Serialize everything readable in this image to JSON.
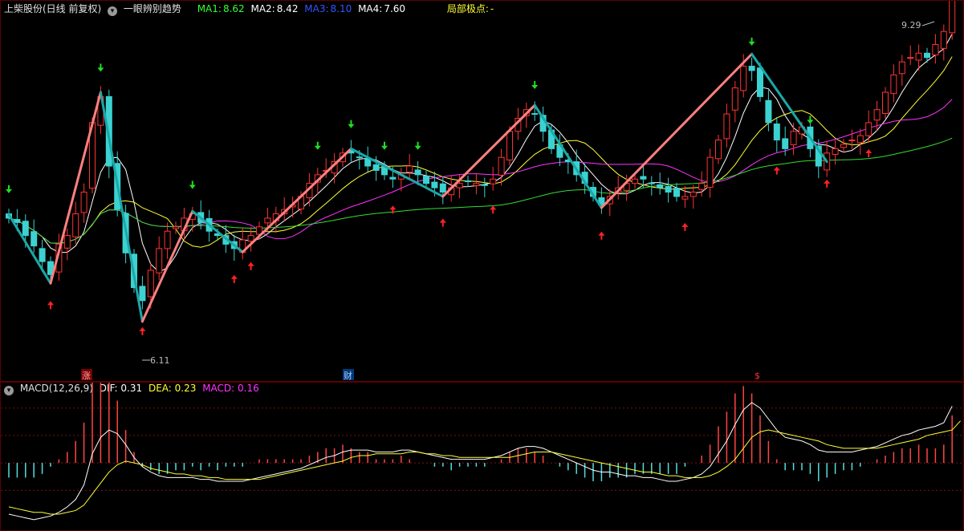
{
  "header": {
    "stock_title": "上柴股份(日线 前复权)",
    "indicator_name": "一眼辨别趋势",
    "ma1": {
      "label": "MA1:",
      "value": "8.62",
      "color": "#33ff33"
    },
    "ma2": {
      "label": "MA2:",
      "value": "8.42",
      "color": "#ffffff"
    },
    "ma3": {
      "label": "MA3:",
      "value": "8.10",
      "color": "#3355ff"
    },
    "ma4": {
      "label": "MA4:",
      "value": "7.60",
      "color": "#ffffff"
    },
    "extreme": {
      "label": "局部极点:",
      "value": "-",
      "color": "#ffff33"
    }
  },
  "macd_header": {
    "name": "MACD(12,26,9)",
    "dif": "DIF: 0.31",
    "dea": "DEA: 0.23",
    "macd": "MACD: 0.16"
  },
  "markers": {
    "up": "涨",
    "cai": "财",
    "s": "$"
  },
  "chart_data": [
    {
      "type": "candlestick",
      "price_range": [
        5.6,
        9.6
      ],
      "max_label": "9.29",
      "min_label": "6.11",
      "up_color": "#ff3333",
      "down_color": "#3cd2d2",
      "ma_colors": {
        "ma5": "#ffffff",
        "ma10": "#ffff33",
        "ma20": "#ff33ff",
        "ma60": "#33dd33"
      },
      "zigzag": [
        [
          0,
          7.34
        ],
        [
          5,
          6.55
        ],
        [
          11,
          8.75
        ],
        [
          16,
          6.11
        ],
        [
          22,
          7.38
        ],
        [
          28,
          6.91
        ],
        [
          41,
          8.1
        ],
        [
          52,
          7.55
        ],
        [
          63,
          8.6
        ],
        [
          71,
          7.42
        ],
        [
          89,
          9.19
        ],
        [
          98,
          7.95
        ]
      ],
      "zigzag_up_color": "#ff8080",
      "zigzag_down_color": "#1aa8a8",
      "turn_markers": [
        {
          "i": 0,
          "dir": "down"
        },
        {
          "i": 5,
          "dir": "up"
        },
        {
          "i": 11,
          "dir": "down"
        },
        {
          "i": 16,
          "dir": "up"
        },
        {
          "i": 22,
          "dir": "down"
        },
        {
          "i": 27,
          "dir": "up"
        },
        {
          "i": 29,
          "dir": "up"
        },
        {
          "i": 37,
          "dir": "down"
        },
        {
          "i": 41,
          "dir": "down"
        },
        {
          "i": 45,
          "dir": "down"
        },
        {
          "i": 46,
          "dir": "up"
        },
        {
          "i": 49,
          "dir": "down"
        },
        {
          "i": 52,
          "dir": "up"
        },
        {
          "i": 58,
          "dir": "up"
        },
        {
          "i": 63,
          "dir": "down"
        },
        {
          "i": 71,
          "dir": "up"
        },
        {
          "i": 81,
          "dir": "up"
        },
        {
          "i": 89,
          "dir": "down"
        },
        {
          "i": 92,
          "dir": "up"
        },
        {
          "i": 96,
          "dir": "down"
        },
        {
          "i": 98,
          "dir": "up"
        },
        {
          "i": 103,
          "dir": "up"
        }
      ],
      "close": [
        7.3,
        7.25,
        7.1,
        6.98,
        6.8,
        6.65,
        7.0,
        7.1,
        7.35,
        7.6,
        8.4,
        8.7,
        7.9,
        7.4,
        6.9,
        6.5,
        6.35,
        6.7,
        6.95,
        7.15,
        7.2,
        7.3,
        7.35,
        7.25,
        7.15,
        7.1,
        7.0,
        6.95,
        7.05,
        7.1,
        7.2,
        7.3,
        7.35,
        7.4,
        7.45,
        7.55,
        7.7,
        7.8,
        7.85,
        7.95,
        8.05,
        8.05,
        8.0,
        7.9,
        7.85,
        7.8,
        7.75,
        7.8,
        7.9,
        7.8,
        7.7,
        7.65,
        7.6,
        7.65,
        7.7,
        7.72,
        7.7,
        7.68,
        7.75,
        8.0,
        8.3,
        8.45,
        8.55,
        8.5,
        8.3,
        8.1,
        8.0,
        7.95,
        7.8,
        7.7,
        7.55,
        7.45,
        7.55,
        7.65,
        7.7,
        7.75,
        7.75,
        7.7,
        7.65,
        7.6,
        7.55,
        7.55,
        7.6,
        7.7,
        8.0,
        8.2,
        8.5,
        8.8,
        9.05,
        9.0,
        8.7,
        8.4,
        8.2,
        8.1,
        8.3,
        8.35,
        8.1,
        7.9,
        8.05,
        8.1,
        8.15,
        8.2,
        8.25,
        8.4,
        8.55,
        8.75,
        8.95,
        9.1,
        9.15,
        9.2,
        9.15,
        9.3,
        9.45,
        10.0
      ],
      "dif": [
        -0.28,
        -0.29,
        -0.3,
        -0.31,
        -0.3,
        -0.29,
        -0.27,
        -0.24,
        -0.2,
        -0.12,
        0.05,
        0.14,
        0.18,
        0.16,
        0.1,
        0.03,
        -0.02,
        -0.05,
        -0.07,
        -0.08,
        -0.08,
        -0.08,
        -0.08,
        -0.09,
        -0.09,
        -0.1,
        -0.1,
        -0.1,
        -0.1,
        -0.09,
        -0.08,
        -0.07,
        -0.06,
        -0.05,
        -0.04,
        -0.03,
        -0.01,
        0.01,
        0.03,
        0.04,
        0.06,
        0.07,
        0.07,
        0.07,
        0.06,
        0.06,
        0.06,
        0.07,
        0.07,
        0.06,
        0.05,
        0.04,
        0.03,
        0.02,
        0.02,
        0.02,
        0.02,
        0.02,
        0.03,
        0.04,
        0.06,
        0.08,
        0.09,
        0.09,
        0.08,
        0.06,
        0.04,
        0.02,
        0.0,
        -0.02,
        -0.04,
        -0.05,
        -0.05,
        -0.06,
        -0.07,
        -0.07,
        -0.08,
        -0.08,
        -0.09,
        -0.1,
        -0.1,
        -0.09,
        -0.08,
        -0.06,
        -0.02,
        0.05,
        0.12,
        0.21,
        0.29,
        0.33,
        0.3,
        0.24,
        0.18,
        0.14,
        0.13,
        0.12,
        0.1,
        0.07,
        0.06,
        0.06,
        0.06,
        0.06,
        0.07,
        0.08,
        0.09,
        0.11,
        0.13,
        0.15,
        0.16,
        0.18,
        0.19,
        0.2,
        0.22,
        0.31
      ],
      "dea": [
        -0.24,
        -0.25,
        -0.26,
        -0.27,
        -0.27,
        -0.28,
        -0.28,
        -0.27,
        -0.26,
        -0.23,
        -0.17,
        -0.11,
        -0.05,
        -0.01,
        0.01,
        0.0,
        -0.01,
        -0.03,
        -0.04,
        -0.05,
        -0.06,
        -0.06,
        -0.07,
        -0.07,
        -0.08,
        -0.08,
        -0.09,
        -0.09,
        -0.09,
        -0.09,
        -0.09,
        -0.08,
        -0.07,
        -0.06,
        -0.05,
        -0.04,
        -0.03,
        -0.02,
        -0.01,
        0.0,
        0.01,
        0.03,
        0.04,
        0.04,
        0.05,
        0.05,
        0.05,
        0.05,
        0.06,
        0.06,
        0.05,
        0.05,
        0.04,
        0.04,
        0.03,
        0.03,
        0.03,
        0.03,
        0.03,
        0.03,
        0.03,
        0.04,
        0.05,
        0.06,
        0.06,
        0.06,
        0.05,
        0.04,
        0.03,
        0.02,
        0.01,
        0.0,
        -0.01,
        -0.02,
        -0.03,
        -0.04,
        -0.05,
        -0.05,
        -0.06,
        -0.07,
        -0.07,
        -0.08,
        -0.08,
        -0.08,
        -0.07,
        -0.05,
        -0.02,
        0.02,
        0.08,
        0.14,
        0.17,
        0.18,
        0.17,
        0.16,
        0.15,
        0.14,
        0.13,
        0.12,
        0.1,
        0.09,
        0.08,
        0.08,
        0.08,
        0.08,
        0.08,
        0.09,
        0.1,
        0.11,
        0.12,
        0.13,
        0.15,
        0.16,
        0.17,
        0.18,
        0.23
      ]
    }
  ]
}
